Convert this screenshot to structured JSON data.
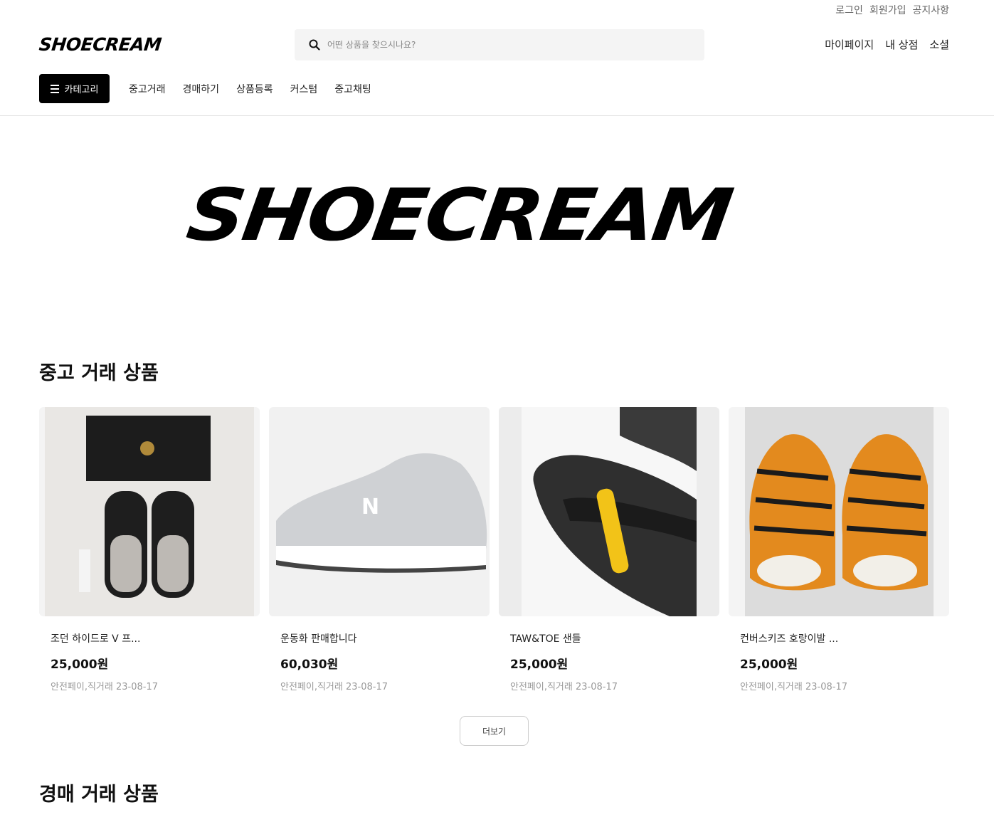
{
  "header": {
    "util_links": [
      "로그인",
      "회원가입",
      "공지사항"
    ],
    "logo": "SHOECREAM",
    "search_placeholder": "어떤 상품을 찾으시나요?",
    "user_nav": [
      "마이페이지",
      "내 상점",
      "소셜"
    ],
    "category_button": "카테고리",
    "main_nav": [
      "중고거래",
      "경매하기",
      "상품등록",
      "커스텀",
      "중고채팅"
    ]
  },
  "hero": {
    "logo_text": "SHOECREAM"
  },
  "used_section": {
    "title": "중고 거래 상품",
    "products": [
      {
        "title": "조던 하이드로 V 프...",
        "price": "25,000원",
        "meta": "안전페이,직거래 23-08-17"
      },
      {
        "title": "운동화 판매합니다",
        "price": "60,030원",
        "meta": "안전페이,직거래 23-08-17"
      },
      {
        "title": "TAW&TOE 샌들",
        "price": "25,000원",
        "meta": "안전페이,직거래 23-08-17"
      },
      {
        "title": "컨버스키즈 호랑이발 ...",
        "price": "25,000원",
        "meta": "안전페이,직거래 23-08-17"
      }
    ],
    "more_label": "더보기"
  },
  "auction_section": {
    "title": "경매 거래 상품"
  }
}
